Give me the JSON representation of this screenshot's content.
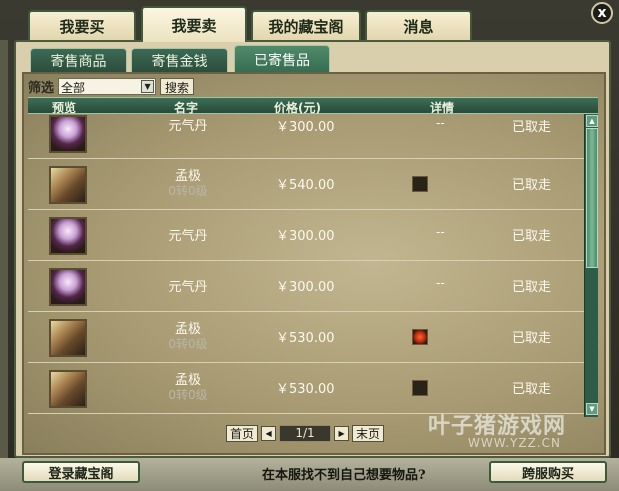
{
  "close_label": "x",
  "tabs": [
    {
      "label": "我要买"
    },
    {
      "label": "我要卖"
    },
    {
      "label": "我的藏宝阁"
    },
    {
      "label": "消息"
    }
  ],
  "subtabs": [
    {
      "label": "寄售商品"
    },
    {
      "label": "寄售金钱"
    },
    {
      "label": "已寄售品"
    }
  ],
  "filter": {
    "label": "筛选",
    "value": "全部",
    "search_label": "搜索"
  },
  "columns": {
    "preview": "预览",
    "name": "名字",
    "price": "价格(元)",
    "detail": "详情"
  },
  "rows": [
    {
      "icon": "orb-item-icon",
      "name": "元气丹",
      "sub": "",
      "price": "￥300.00",
      "detail": "--",
      "status": "已取走"
    },
    {
      "icon": "dragon-pet-icon",
      "name": "孟极",
      "sub": "0转0级",
      "price": "￥540.00",
      "detail": "",
      "status": "已取走"
    },
    {
      "icon": "orb-item-icon",
      "name": "元气丹",
      "sub": "",
      "price": "￥300.00",
      "detail": "--",
      "status": "已取走"
    },
    {
      "icon": "orb-item-icon",
      "name": "元气丹",
      "sub": "",
      "price": "￥300.00",
      "detail": "--",
      "status": "已取走"
    },
    {
      "icon": "dragon-pet-icon",
      "name": "孟极",
      "sub": "0转0级",
      "price": "￥530.00",
      "detail": "",
      "status": "已取走"
    },
    {
      "icon": "dragon-pet-icon",
      "name": "孟极",
      "sub": "0转0级",
      "price": "￥530.00",
      "detail": "",
      "status": "已取走"
    }
  ],
  "pager": {
    "first": "首页",
    "page": "1/1",
    "last": "末页"
  },
  "watermark": {
    "main": "叶子猪游戏网",
    "sub": "WWW.YZZ.CN"
  },
  "bottom": {
    "login": "登录藏宝阁",
    "prompt": "在本服找不到自己想要物品?",
    "cross": "跨服购买"
  }
}
